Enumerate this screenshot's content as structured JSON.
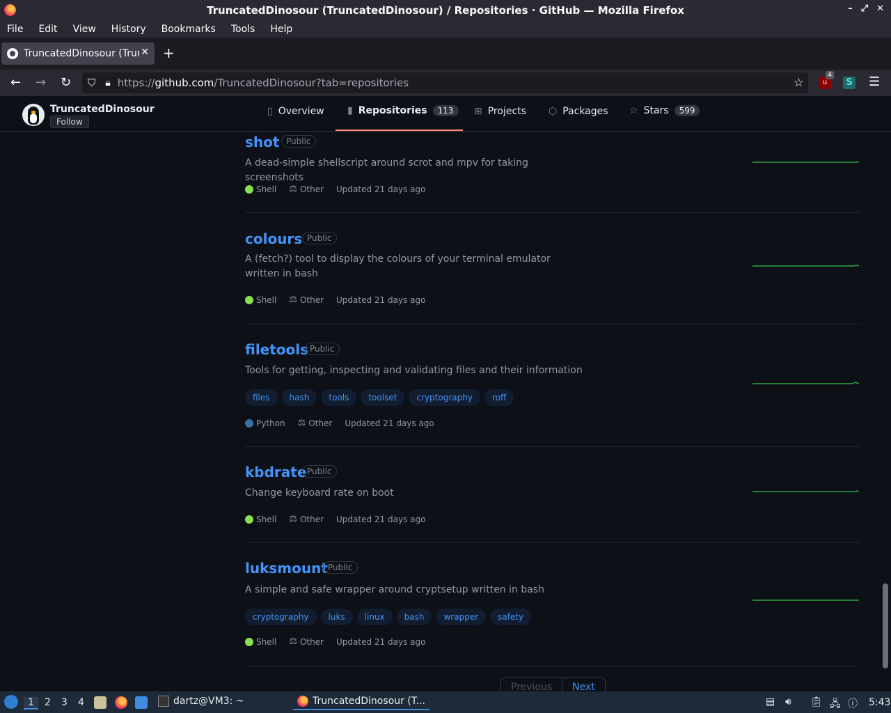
{
  "window": {
    "title": "TruncatedDinosour (TruncatedDinosour) / Repositories · GitHub — Mozilla Firefox",
    "controls": [
      "–",
      "⤢",
      "✕"
    ]
  },
  "menu": [
    "File",
    "Edit",
    "View",
    "History",
    "Bookmarks",
    "Tools",
    "Help"
  ],
  "tab": {
    "title": "TruncatedDinosour (TruncatedDinosour)",
    "close": "✕",
    "new": "+"
  },
  "nav": {
    "url_prefix": "https://",
    "url_domain": "github.com",
    "url_path": "/TruncatedDinosour?tab=repositories",
    "ext_badge": "4"
  },
  "profile": {
    "username": "TruncatedDinosour",
    "follow": "Follow",
    "tabs": [
      {
        "label": "Overview",
        "icon": "book-icon"
      },
      {
        "label": "Repositories",
        "icon": "repo-icon",
        "count": "113"
      },
      {
        "label": "Projects",
        "icon": "table-icon"
      },
      {
        "label": "Packages",
        "icon": "package-icon"
      },
      {
        "label": "Stars",
        "icon": "star-icon",
        "count": "599"
      }
    ]
  },
  "repos": [
    {
      "name": "shot",
      "visibility": "Public",
      "description": "A dead-simple shellscript around scrot and mpv for taking screenshots",
      "language": "Shell",
      "language_color": "#89e051",
      "license": "Other",
      "updated": "Updated 21 days ago",
      "topics": []
    },
    {
      "name": "colours",
      "visibility": "Public",
      "description": "A (fetch?) tool to display the colours of your terminal emulator written in bash",
      "language": "Shell",
      "language_color": "#89e051",
      "license": "Other",
      "updated": "Updated 21 days ago",
      "topics": []
    },
    {
      "name": "filetools",
      "visibility": "Public",
      "description": "Tools for getting, inspecting and validating files and their information",
      "language": "Python",
      "language_color": "#3572A5",
      "license": "Other",
      "updated": "Updated 21 days ago",
      "topics": [
        "files",
        "hash",
        "tools",
        "toolset",
        "cryptography",
        "roff"
      ]
    },
    {
      "name": "kbdrate",
      "visibility": "Public",
      "description": "Change keyboard rate on boot",
      "language": "Shell",
      "language_color": "#89e051",
      "license": "Other",
      "updated": "Updated 21 days ago",
      "topics": []
    },
    {
      "name": "luksmount",
      "visibility": "Public",
      "description": "A simple and safe wrapper around cryptsetup written in bash",
      "language": "Shell",
      "language_color": "#89e051",
      "license": "Other",
      "updated": "Updated 21 days ago",
      "topics": [
        "cryptography",
        "luks",
        "linux",
        "bash",
        "wrapper",
        "safety"
      ]
    }
  ],
  "pagination": {
    "previous": "Previous",
    "next": "Next"
  },
  "taskbar": {
    "workspaces": [
      "1",
      "2",
      "3",
      "4"
    ],
    "tasks": [
      "dartz@VM3: ~",
      "TruncatedDinosour (T..."
    ],
    "clock": "5:43"
  },
  "colors": {
    "accent": "#4493f8",
    "underline": "#fd8c73",
    "spark": "#2ea043"
  }
}
